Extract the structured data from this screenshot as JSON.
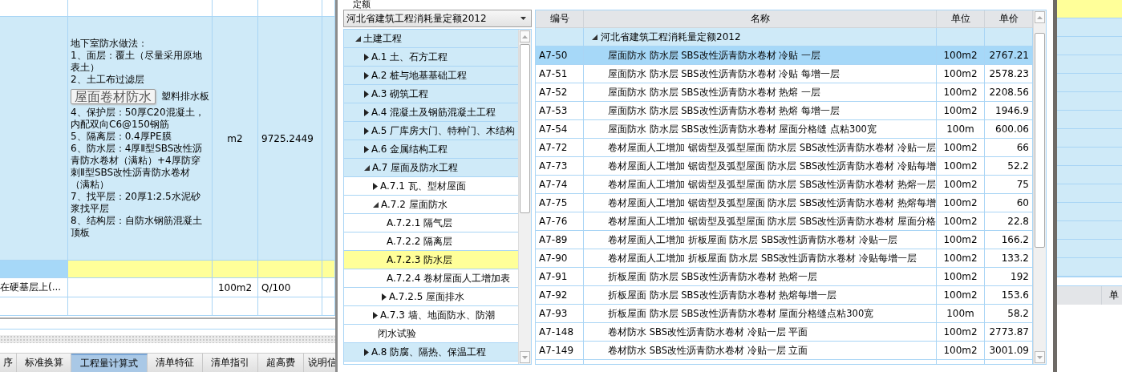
{
  "left_panel": {
    "main_row": {
      "description_before": [
        "地下室防水做法：",
        "1、面层：覆土（尽量采用原地表土）",
        "2、土工布过滤层"
      ],
      "tooltip": "屋面卷材防水",
      "beside_tooltip": "塑料排水板",
      "description_after": [
        "4、保护层：50厚C20混凝土，内配双向C6@150钢筋",
        "5、隔离层：0.4厚PE膜",
        "6、防水层：4厚Ⅱ型SBS改性沥青防水卷材（满粘）+4厚防穿刺Ⅱ型SBS改性沥青防水卷材（满粘）",
        "7、找平层：20厚1:2.5水泥砂浆找平层",
        "8、结构层：自防水钢筋混凝土顶板"
      ],
      "unit": "m2",
      "quantity": "9725.2449"
    },
    "sub_row": {
      "name": "在硬基层上(...",
      "unit": "100m2",
      "quantity": "Q/100"
    },
    "tabs": [
      {
        "label": "序",
        "selected": false
      },
      {
        "label": "标准换算",
        "selected": false
      },
      {
        "label": "工程量计算式",
        "selected": true
      },
      {
        "label": "清单特征",
        "selected": false
      },
      {
        "label": "清单指引",
        "selected": false
      },
      {
        "label": "超高费",
        "selected": false
      },
      {
        "label": "说明信",
        "selected": false
      }
    ]
  },
  "dialog": {
    "section_label": "定额",
    "library_dropdown": "河北省建筑工程消耗量定额2012",
    "tree": {
      "items": [
        {
          "label": "土建工程",
          "expanded": true,
          "selected": false,
          "children": [
            {
              "label": "A.1 土、石方工程",
              "expanded": false,
              "selected": false
            },
            {
              "label": "A.2 桩与地基基础工程",
              "expanded": false,
              "selected": false
            },
            {
              "label": "A.3 砌筑工程",
              "expanded": false,
              "selected": false
            },
            {
              "label": "A.4 混凝土及钢筋混凝土工程",
              "expanded": false,
              "selected": false
            },
            {
              "label": "A.5 厂库房大门、特种门、木结构",
              "expanded": false,
              "selected": false
            },
            {
              "label": "A.6 金属结构工程",
              "expanded": false,
              "selected": false
            },
            {
              "label": "A.7 屋面及防水工程",
              "expanded": true,
              "selected": false,
              "children": [
                {
                  "label": "A.7.1 瓦、型材屋面",
                  "expanded": false,
                  "selected": false
                },
                {
                  "label": "A.7.2 屋面防水",
                  "expanded": true,
                  "selected": false,
                  "children": [
                    {
                      "label": "A.7.2.1 隔气层",
                      "selected": false
                    },
                    {
                      "label": "A.7.2.2 隔离层",
                      "selected": false
                    },
                    {
                      "label": "A.7.2.3 防水层",
                      "selected": true
                    },
                    {
                      "label": "A.7.2.4 卷材屋面人工增加表",
                      "selected": false
                    },
                    {
                      "label": "A.7.2.5 屋面排水",
                      "expanded": false,
                      "selected": false
                    }
                  ]
                },
                {
                  "label": "A.7.3 墙、地面防水、防潮",
                  "expanded": false,
                  "selected": false
                },
                {
                  "label": "闭水试验",
                  "selected": false
                }
              ]
            },
            {
              "label": "A.8 防腐、隔热、保温工程",
              "expanded": false,
              "selected": false
            }
          ]
        }
      ]
    },
    "table": {
      "columns": [
        "编号",
        "名称",
        "单位",
        "单价"
      ],
      "group": {
        "label": "河北省建筑工程消耗量定额2012",
        "expanded": true
      },
      "rows": [
        {
          "code": "A7-50",
          "name": "屋面防水 防水层 SBS改性沥青防水卷材 冷贴 一层",
          "unit": "100m2",
          "price": "2767.21",
          "selected": true
        },
        {
          "code": "A7-51",
          "name": "屋面防水 防水层 SBS改性沥青防水卷材 冷贴 每增一层",
          "unit": "100m2",
          "price": "2578.23",
          "selected": false
        },
        {
          "code": "A7-52",
          "name": "屋面防水 防水层 SBS改性沥青防水卷材 热熔 一层",
          "unit": "100m2",
          "price": "2208.56",
          "selected": false
        },
        {
          "code": "A7-53",
          "name": "屋面防水 防水层 SBS改性沥青防水卷材 热熔 每增一层",
          "unit": "100m2",
          "price": "1946.9",
          "selected": false
        },
        {
          "code": "A7-54",
          "name": "屋面防水 防水层 SBS改性沥青防水卷材 屋面分格缝 点粘300宽",
          "unit": "100m",
          "price": "600.06",
          "selected": false
        },
        {
          "code": "A7-72",
          "name": "卷材屋面人工增加 锯齿型及弧型屋面 防水层 SBS改性沥青防水卷材 冷贴一层",
          "unit": "100m2",
          "price": "66",
          "selected": false
        },
        {
          "code": "A7-73",
          "name": "卷材屋面人工增加 锯齿型及弧型屋面 防水层 SBS改性沥青防水卷材 冷贴每增",
          "unit": "100m2",
          "price": "52.2",
          "selected": false
        },
        {
          "code": "A7-74",
          "name": "卷材屋面人工增加 锯齿型及弧型屋面 防水层 SBS改性沥青防水卷材 热熔一层",
          "unit": "100m2",
          "price": "75",
          "selected": false
        },
        {
          "code": "A7-75",
          "name": "卷材屋面人工增加 锯齿型及弧型屋面 防水层 SBS改性沥青防水卷材 热熔每增",
          "unit": "100m2",
          "price": "60",
          "selected": false
        },
        {
          "code": "A7-76",
          "name": "卷材屋面人工增加 锯齿型及弧型屋面 防水层 SBS改性沥青防水卷材 屋面分格",
          "unit": "100m2",
          "price": "22.8",
          "selected": false
        },
        {
          "code": "A7-89",
          "name": "卷材屋面人工增加 折板屋面 防水层 SBS改性沥青防水卷材 冷贴一层",
          "unit": "100m2",
          "price": "166.2",
          "selected": false
        },
        {
          "code": "A7-90",
          "name": "卷材屋面人工增加 折板屋面 防水层 SBS改性沥青防水卷材 冷贴每增一层",
          "unit": "100m2",
          "price": "133.2",
          "selected": false
        },
        {
          "code": "A7-91",
          "name": "折板屋面 防水层 SBS改性沥青防水卷材 热熔一层",
          "unit": "100m2",
          "price": "192",
          "selected": false
        },
        {
          "code": "A7-92",
          "name": "折板屋面 防水层 SBS改性沥青防水卷材 热熔每增一层",
          "unit": "100m2",
          "price": "153.6",
          "selected": false
        },
        {
          "code": "A7-93",
          "name": "折板屋面 防水层 SBS改性沥青防水卷材 屋面分格缝点粘300宽",
          "unit": "100m",
          "price": "58.2",
          "selected": false
        },
        {
          "code": "A7-148",
          "name": "卷材防水 SBS改性沥青防水卷材 冷贴一层 平面",
          "unit": "100m2",
          "price": "2773.87",
          "selected": false
        },
        {
          "code": "A7-149",
          "name": "卷材防水 SBS改性沥青防水卷材 冷贴一层 立面",
          "unit": "100m2",
          "price": "3001.09",
          "selected": false
        }
      ]
    }
  },
  "right_panel": {
    "rows": [
      {
        "selected": true
      },
      {
        "selected": false
      },
      {
        "selected": false
      },
      {
        "selected": false
      },
      {
        "selected": false
      },
      {
        "selected": false
      },
      {
        "selected": false
      },
      {
        "selected": false
      },
      {
        "selected": false
      },
      {
        "selected": false
      },
      {
        "selected": false
      },
      {
        "selected": false
      },
      {
        "selected": false
      },
      {
        "selected": false
      },
      {
        "selected": false
      }
    ],
    "column_header": "单"
  }
}
